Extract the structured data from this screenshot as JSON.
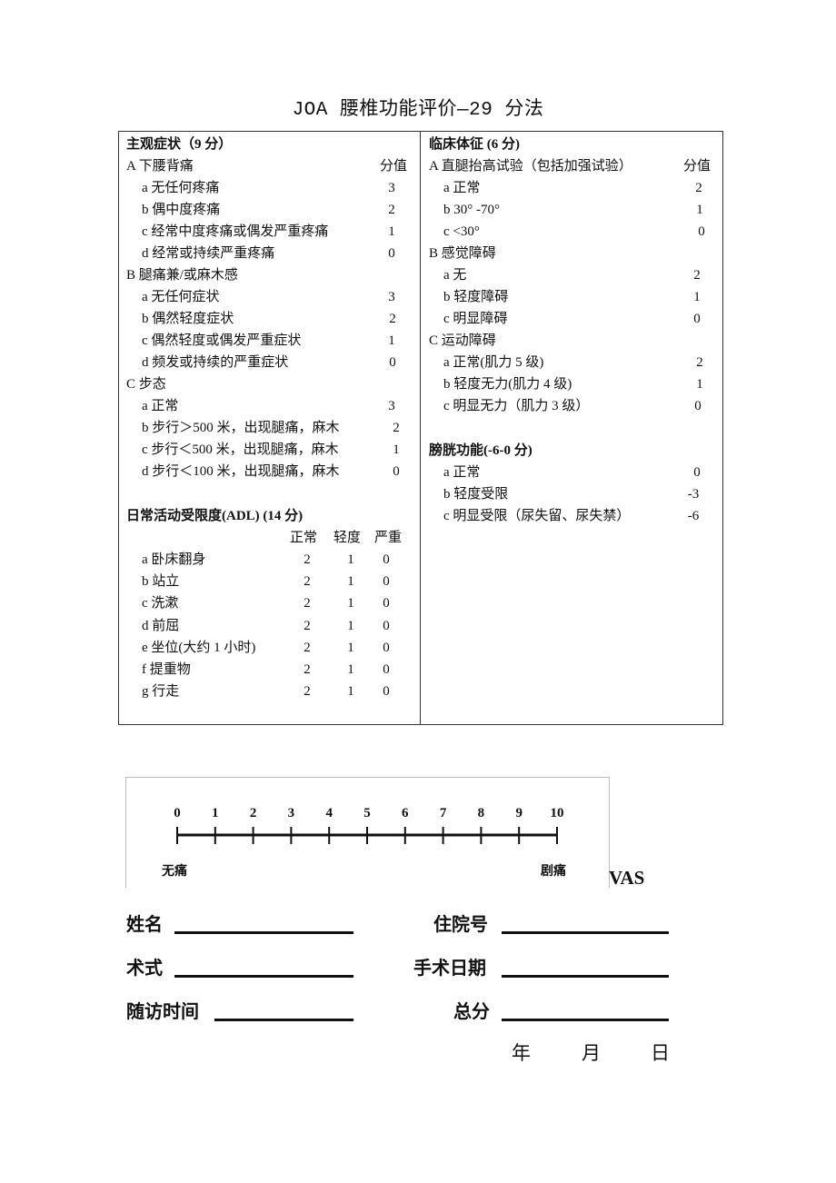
{
  "title": "JOA 腰椎功能评价—29 分法",
  "left": {
    "subjective": {
      "heading": "主观症状（9 分）",
      "score_header": "分值",
      "groups": [
        {
          "label": "A 下腰背痛",
          "items": [
            {
              "label": "a 无任何疼痛",
              "score": "3"
            },
            {
              "label": "b 偶中度疼痛",
              "score": "2"
            },
            {
              "label": "c 经常中度疼痛或偶发严重疼痛",
              "score": "1"
            },
            {
              "label": "d 经常或持续严重疼痛",
              "score": "0"
            }
          ]
        },
        {
          "label": "B 腿痛兼/或麻木感",
          "items": [
            {
              "label": "a 无任何症状",
              "score": "3"
            },
            {
              "label": "b 偶然轻度症状",
              "score": "2"
            },
            {
              "label": "c 偶然轻度或偶发严重症状",
              "score": "1"
            },
            {
              "label": "d 频发或持续的严重症状",
              "score": "0"
            }
          ]
        },
        {
          "label": "C 步态",
          "items": [
            {
              "label": "a 正常",
              "score": "3"
            },
            {
              "label": "b 步行＞500 米，出现腿痛，麻木",
              "score": "2"
            },
            {
              "label": "c 步行＜500 米，出现腿痛，麻木",
              "score": "1"
            },
            {
              "label": "d 步行＜100 米，出现腿痛，麻木",
              "score": "0"
            }
          ]
        }
      ]
    },
    "adl": {
      "heading": "日常活动受限度(ADL) (14 分)",
      "columns": [
        "正常",
        "轻度",
        "严重"
      ],
      "rows": [
        {
          "label": "a 卧床翻身",
          "scores": [
            "2",
            "1",
            "0"
          ]
        },
        {
          "label": "b 站立",
          "scores": [
            "2",
            "1",
            "0"
          ]
        },
        {
          "label": "c 洗漱",
          "scores": [
            "2",
            "1",
            "0"
          ]
        },
        {
          "label": "d 前屈",
          "scores": [
            "2",
            "1",
            "0"
          ]
        },
        {
          "label": "e 坐位(大约 1 小时)",
          "scores": [
            "2",
            "1",
            "0"
          ]
        },
        {
          "label": "f 提重物",
          "scores": [
            "2",
            "1",
            "0"
          ]
        },
        {
          "label": "g 行走",
          "scores": [
            "2",
            "1",
            "0"
          ]
        }
      ]
    }
  },
  "right": {
    "clinical": {
      "heading": "临床体征 (6 分)",
      "score_header": "分值",
      "groups": [
        {
          "label": "A 直腿抬高试验（包括加强试验）",
          "items": [
            {
              "label": "a 正常",
              "score": "2"
            },
            {
              "label": "b 30° -70°",
              "score": "1"
            },
            {
              "label": "c <30°",
              "score": "0"
            }
          ]
        },
        {
          "label": "B 感觉障碍",
          "items": [
            {
              "label": "a 无",
              "score": "2"
            },
            {
              "label": "b 轻度障碍",
              "score": "1"
            },
            {
              "label": "c 明显障碍",
              "score": "0"
            }
          ]
        },
        {
          "label": "C 运动障碍",
          "items": [
            {
              "label": "a 正常(肌力 5 级)",
              "score": "2"
            },
            {
              "label": "b 轻度无力(肌力 4 级)",
              "score": "1"
            },
            {
              "label": "c  明显无力（肌力 3 级）",
              "score": "0"
            }
          ]
        }
      ]
    },
    "bladder": {
      "heading": "膀胱功能(-6-0 分)",
      "items": [
        {
          "label": "a 正常",
          "score": "0"
        },
        {
          "label": "b 轻度受限",
          "score": "-3"
        },
        {
          "label": "c 明显受限（尿失留、尿失禁）",
          "score": "-6"
        }
      ]
    }
  },
  "vas": {
    "title": "VAS",
    "ticks": [
      "0",
      "1",
      "2",
      "3",
      "4",
      "5",
      "6",
      "7",
      "8",
      "9",
      "10"
    ],
    "min_label": "无痛",
    "max_label": "剧痛"
  },
  "form": {
    "name": "姓名",
    "admission_no": "住院号",
    "procedure": "术式",
    "surgery_date": "手术日期",
    "followup_time": "随访时间",
    "total_score": "总分",
    "year": "年",
    "month": "月",
    "day": "日"
  }
}
